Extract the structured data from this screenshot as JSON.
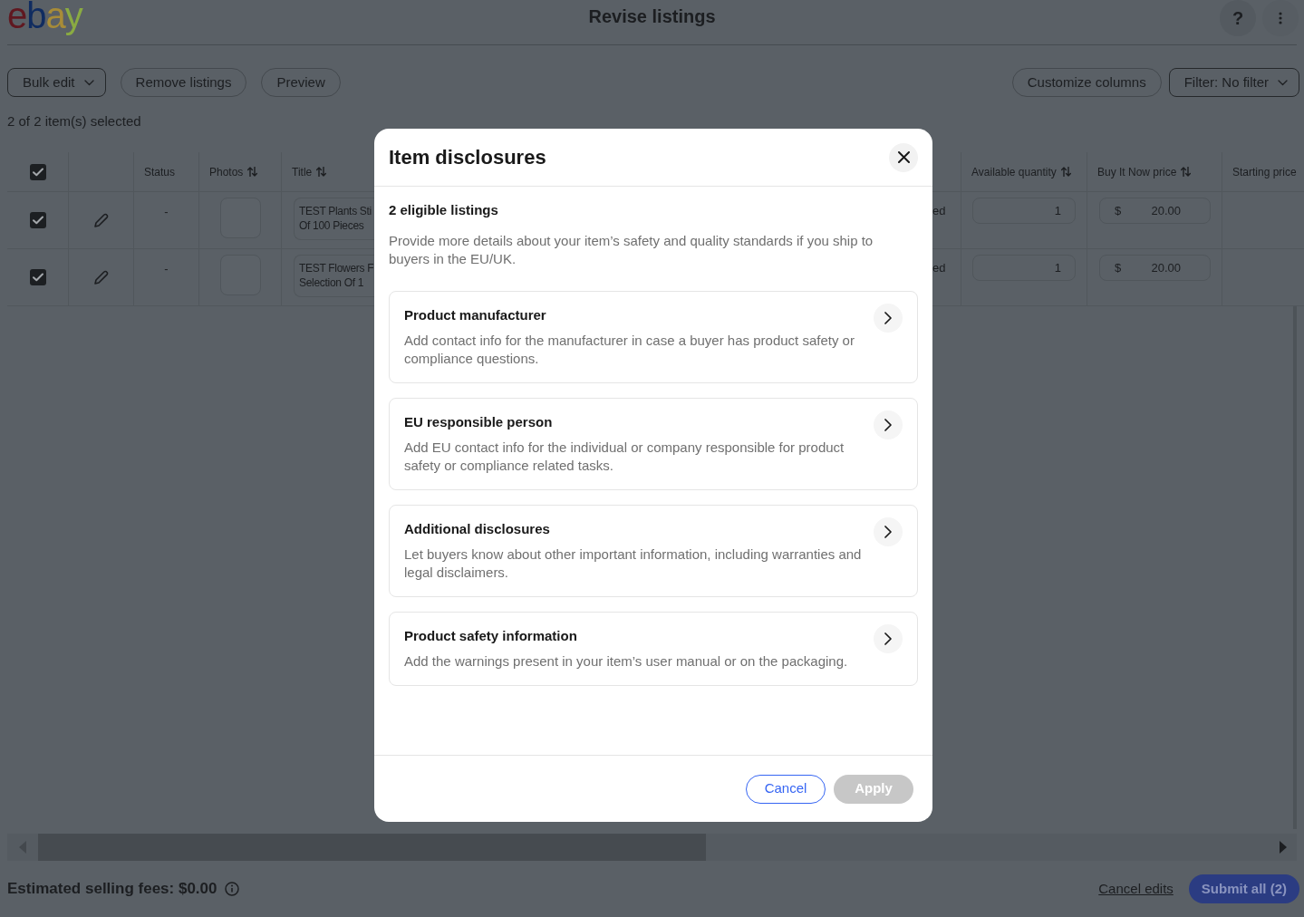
{
  "header": {
    "logo": "ebay",
    "title": "Revise listings",
    "help_button": "?"
  },
  "toolbar": {
    "left": [
      {
        "label": "Bulk edit",
        "kind": "dropdown"
      },
      {
        "label": "Remove listings",
        "kind": "pill"
      },
      {
        "label": "Preview",
        "kind": "pill"
      }
    ],
    "right": [
      {
        "label": "Customize columns",
        "kind": "pill"
      },
      {
        "label": "Filter: No filter",
        "kind": "dropdown"
      }
    ]
  },
  "selection_summary": "2 of 2 item(s) selected",
  "table": {
    "select_all_checked": true,
    "columns": [
      {
        "label": "Status",
        "sortable": false
      },
      {
        "label": "Photos",
        "sortable": true
      },
      {
        "label": "Title",
        "sortable": true
      },
      {
        "label": "Available quantity",
        "sortable": true
      },
      {
        "label": "Buy It Now price",
        "sortable": true
      },
      {
        "label": "Starting price",
        "sortable": false
      }
    ],
    "rows": [
      {
        "checked": true,
        "status": "-",
        "title_lines": [
          "TEST Plants Sti",
          "Of 100 Pieces"
        ],
        "column_6": "ed",
        "available_quantity": "1",
        "currency": "$",
        "buy_it_now_price": "20.00"
      },
      {
        "checked": true,
        "status": "-",
        "title_lines": [
          "TEST Flowers F",
          "Selection Of 1"
        ],
        "column_6": "ed",
        "available_quantity": "1",
        "currency": "$",
        "buy_it_now_price": "20.00"
      }
    ]
  },
  "footer": {
    "fees": "Estimated selling fees: $0.00",
    "cancel_link": "Cancel edits",
    "submit_button": "Submit all (2)"
  },
  "dialog": {
    "title": "Item disclosures",
    "eligible_count": "2 eligible listings",
    "description": "Provide more details about your item’s safety and quality standards if you ship to buyers in the EU/UK.",
    "sections": [
      {
        "title": "Product manufacturer",
        "description": "Add contact info for the manufacturer in case a buyer has product safety or compliance questions."
      },
      {
        "title": "EU responsible person",
        "description": "Add EU contact info for the individual or company responsible for product safety or compliance related tasks."
      },
      {
        "title": "Additional disclosures",
        "description": "Let buyers know about other important information, including warranties and legal disclaimers."
      },
      {
        "title": "Product safety information",
        "description": "Add the warnings present in your item’s user manual or on the packaging."
      }
    ],
    "buttons": [
      {
        "label": "Cancel",
        "kind": "secondary",
        "disabled": false
      },
      {
        "label": "Apply",
        "kind": "primary",
        "disabled": true
      }
    ]
  }
}
